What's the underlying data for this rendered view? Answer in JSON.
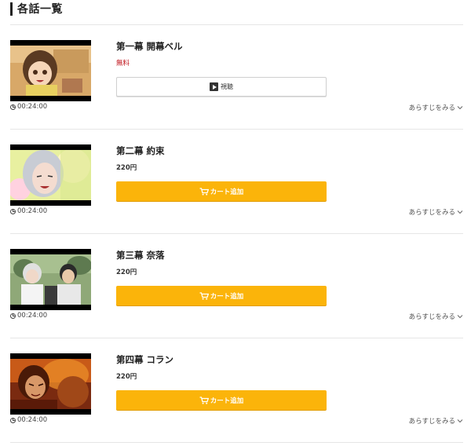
{
  "section": {
    "title": "各話一覧"
  },
  "episodes": [
    {
      "title": "第一幕 開幕ベル",
      "price": "無料",
      "price_type": "free",
      "action": "watch",
      "action_label": "視聴",
      "duration": "00:24:00",
      "synopsis_label": "あらすじをみる"
    },
    {
      "title": "第二幕 約束",
      "price": "220円",
      "price_type": "paid",
      "action": "cart",
      "action_label": "カート追加",
      "duration": "00:24:00",
      "synopsis_label": "あらすじをみる"
    },
    {
      "title": "第三幕 奈落",
      "price": "220円",
      "price_type": "paid",
      "action": "cart",
      "action_label": "カート追加",
      "duration": "00:24:00",
      "synopsis_label": "あらすじをみる"
    },
    {
      "title": "第四幕 コラン",
      "price": "220円",
      "price_type": "paid",
      "action": "cart",
      "action_label": "カート追加",
      "duration": "00:24:00",
      "synopsis_label": "あらすじをみる"
    }
  ],
  "colors": {
    "cart_button": "#fbb40a",
    "free_price": "#c0161d",
    "divider": "#e6e6e6"
  },
  "icons": {
    "watch": "play-icon",
    "cart": "cart-icon",
    "duration": "clock-icon",
    "synopsis": "chevron-down-icon"
  }
}
